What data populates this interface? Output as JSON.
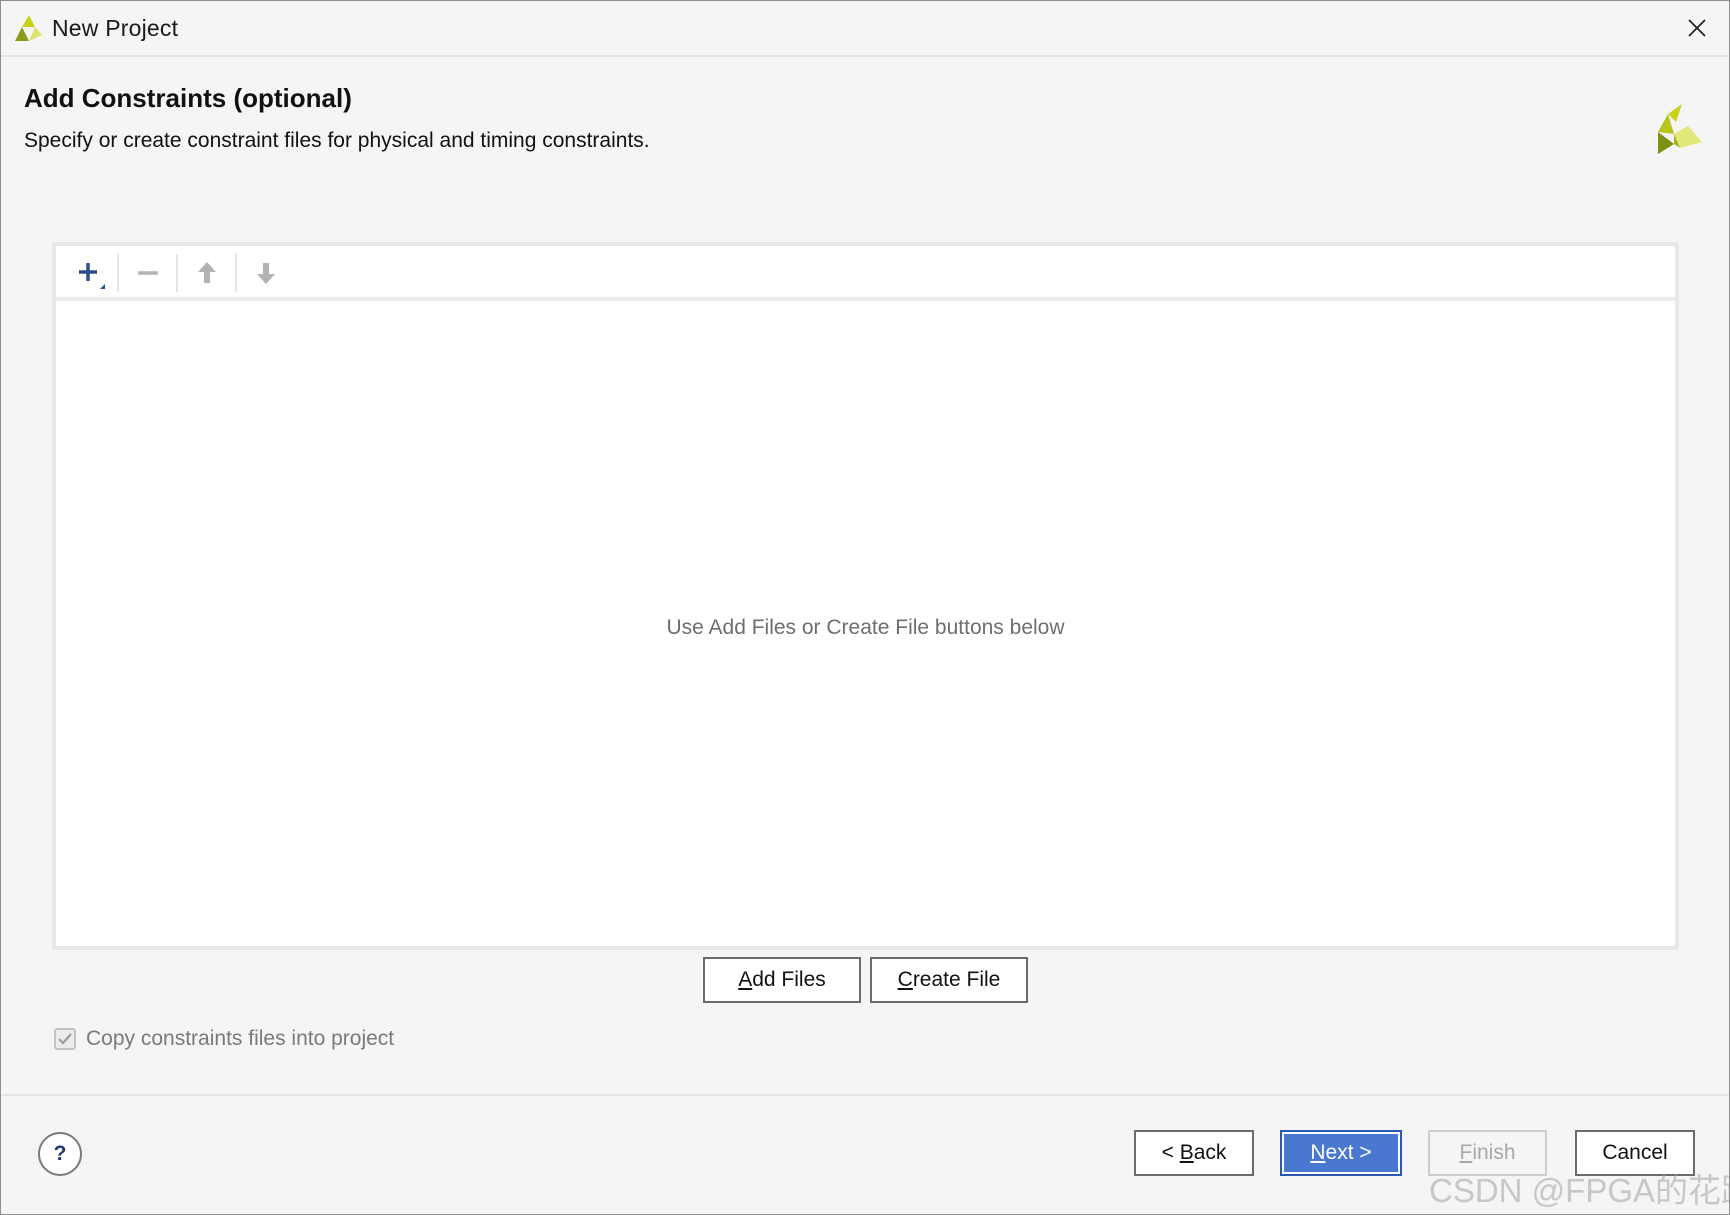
{
  "window": {
    "title": "New Project"
  },
  "header": {
    "title": "Add Constraints (optional)",
    "subtitle": "Specify or create constraint files for physical and timing constraints."
  },
  "toolbar": {
    "buttons": [
      {
        "name": "add",
        "icon": "plus-icon",
        "enabled": true
      },
      {
        "name": "remove",
        "icon": "minus-icon",
        "enabled": false
      },
      {
        "name": "move-up",
        "icon": "arrow-up-icon",
        "enabled": false
      },
      {
        "name": "move-down",
        "icon": "arrow-down-icon",
        "enabled": false
      }
    ]
  },
  "file_list": {
    "empty_hint": "Use Add Files or Create File buttons below"
  },
  "actions": {
    "add_files": {
      "mnemonic": "A",
      "rest": "dd Files"
    },
    "create_file": {
      "mnemonic": "C",
      "rest": "reate File"
    }
  },
  "options": {
    "copy_constraints_label": "Copy constraints files into project",
    "copy_constraints_checked": true,
    "copy_constraints_enabled": false
  },
  "footer": {
    "help_label": "?",
    "back": {
      "prefix": "< ",
      "mnemonic": "B",
      "rest": "ack"
    },
    "next": {
      "mnemonic": "N",
      "rest": "ext >"
    },
    "finish": {
      "mnemonic": "F",
      "rest": "inish",
      "enabled": false
    },
    "cancel": {
      "label": "Cancel"
    }
  },
  "watermark": "CSDN @FPGA的花路",
  "colors": {
    "accent": "#4a78d0",
    "brand_yellow": "#c9d21b",
    "brand_olive": "#8a9a1a",
    "toolbar_icon": "#2d4d8a"
  }
}
